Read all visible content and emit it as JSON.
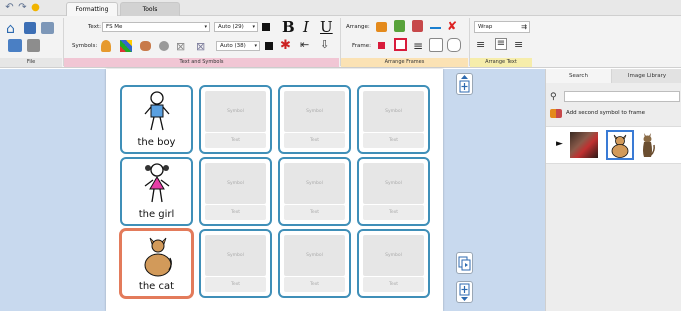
{
  "tabs": {
    "formatting": "Formatting",
    "tools": "Tools"
  },
  "text_row": {
    "label": "Text:",
    "font": "FS Me",
    "size": "Auto (29)",
    "bold": "B",
    "italic": "I",
    "underline": "U"
  },
  "symbols_row": {
    "label": "Symbols:",
    "size": "Auto (38)"
  },
  "arrange": {
    "label": "Arrange:",
    "frame_label": "Frame:"
  },
  "wrap": {
    "label": "Wrap"
  },
  "sections": {
    "file": "File",
    "text_symbols": "Text and Symbols",
    "arrange_frames": "Arrange Frames",
    "arrange_text": "Arrange Text"
  },
  "cells": [
    {
      "label": "the boy"
    },
    {
      "label": "the girl"
    },
    {
      "label": "the cat"
    }
  ],
  "placeholder": {
    "symbol": "Symbol",
    "text": "Text"
  },
  "panel": {
    "tab_search": "Search",
    "tab_library": "Image Library",
    "search_value": "",
    "add_second": "Add second symbol to frame"
  },
  "colors": {
    "cell_border": "#3f8fb8",
    "selected_border": "#e37b5b",
    "canvas_bg": "#c8d9ee"
  }
}
